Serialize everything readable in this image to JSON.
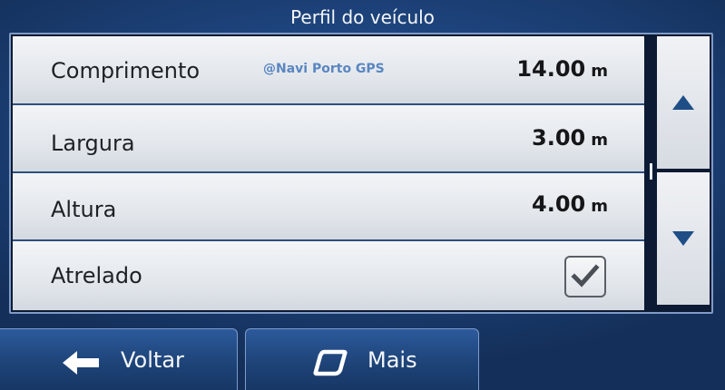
{
  "header": {
    "title": "Perfil do veículo"
  },
  "watermark": "@Navi Porto GPS",
  "rows": [
    {
      "label": "Comprimento",
      "value": "14.00",
      "unit": "m"
    },
    {
      "label": "Largura",
      "value": "3.00",
      "unit": "m"
    },
    {
      "label": "Altura",
      "value": "4.00",
      "unit": "m"
    },
    {
      "label": "Atrelado",
      "checked": true
    }
  ],
  "scroll": {
    "up_icon": "triangle-up-icon",
    "down_icon": "triangle-down-icon"
  },
  "footer": {
    "back_label": "Voltar",
    "back_icon": "arrow-left-icon",
    "more_label": "Mais",
    "more_icon": "more-shape-icon"
  },
  "colors": {
    "accent": "#1c4178",
    "row_bg": "#e3e7ec",
    "arrow": "#1f4e86"
  }
}
